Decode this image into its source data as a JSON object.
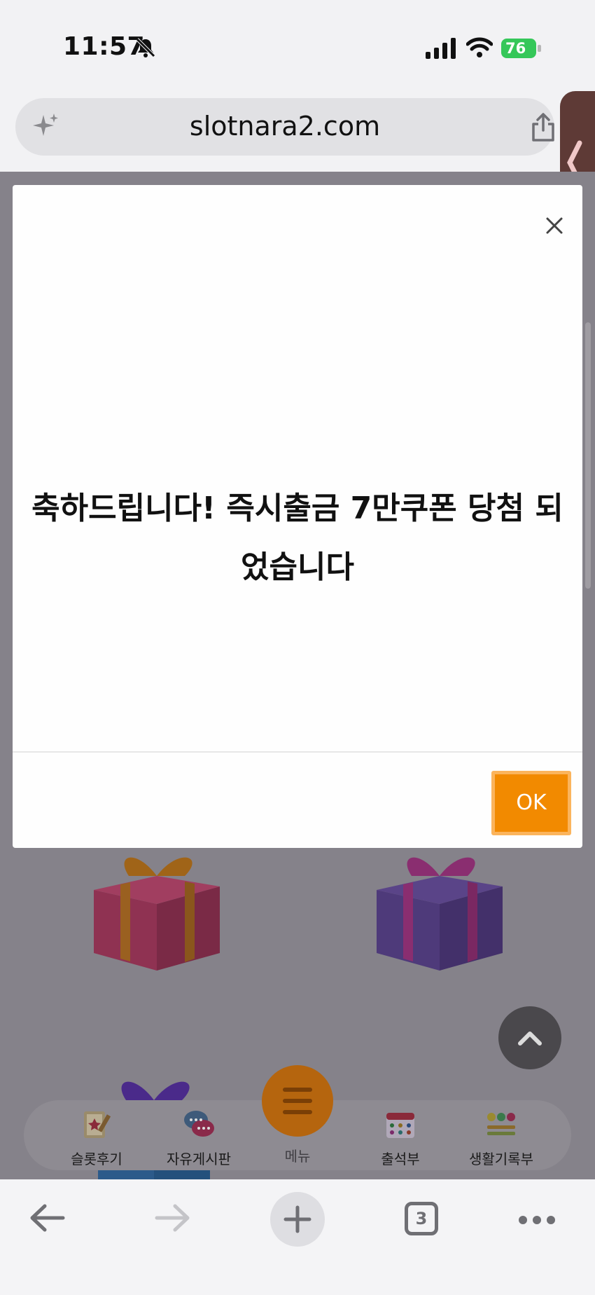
{
  "status_bar": {
    "time": "11:57",
    "battery": "76",
    "icons": [
      "bell-slash-icon",
      "cellular-signal-icon",
      "wifi-icon",
      "battery-charging-icon"
    ],
    "battery_color": "#35c759"
  },
  "browser": {
    "url": "slotnara2.com",
    "tab_count": "3",
    "icons": [
      "sparkle-icon",
      "share-icon",
      "back-arrow-icon",
      "forward-arrow-icon",
      "plus-icon",
      "tabs-icon",
      "more-dots-icon"
    ]
  },
  "modal": {
    "message": "축하드립니다! 즉시출금 7만쿠폰 당첨 되었습니다",
    "ok_label": "OK",
    "accent_color": "#f28a00"
  },
  "bottom_nav": {
    "items": [
      {
        "label": "슬롯후기",
        "icon": "review-notepad-icon"
      },
      {
        "label": "자유게시판",
        "icon": "chat-bubbles-icon"
      },
      {
        "label": "메뉴",
        "icon": "hamburger-menu-icon"
      },
      {
        "label": "출석부",
        "icon": "calendar-icon"
      },
      {
        "label": "생활기록부",
        "icon": "emoji-record-icon"
      }
    ]
  }
}
